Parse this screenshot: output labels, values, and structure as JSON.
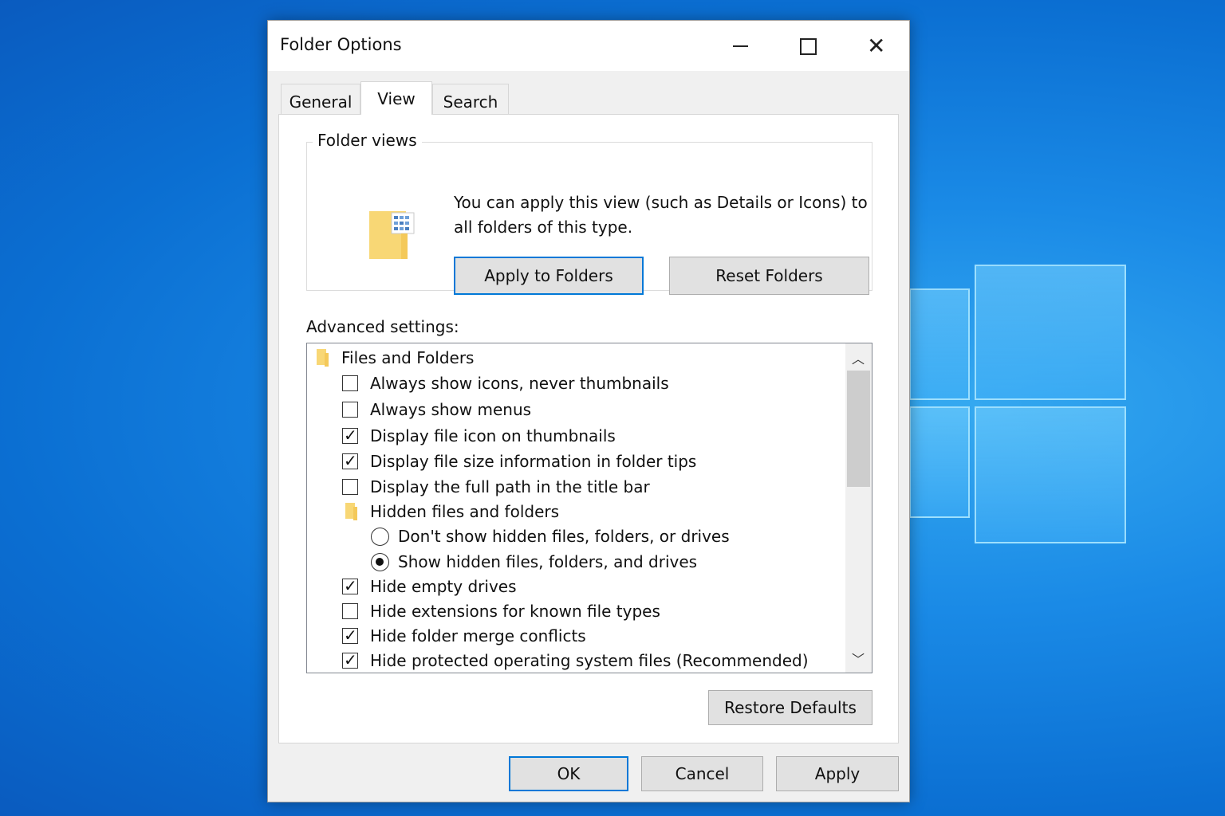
{
  "window": {
    "title": "Folder Options",
    "minimize_icon": "minimize-icon",
    "maximize_icon": "maximize-icon",
    "close_icon": "close-icon",
    "close_glyph": "✕"
  },
  "tabs": [
    {
      "label": "General",
      "active": false
    },
    {
      "label": "View",
      "active": true
    },
    {
      "label": "Search",
      "active": false
    }
  ],
  "folder_views": {
    "label": "Folder views",
    "description": "You can apply this view (such as Details or Icons) to all folders of this type.",
    "apply_button": "Apply to Folders",
    "reset_button": "Reset Folders"
  },
  "advanced": {
    "label": "Advanced settings:",
    "items": [
      {
        "type": "folder",
        "label": "Files and Folders"
      },
      {
        "type": "checkbox",
        "label": "Always show icons, never thumbnails",
        "checked": false
      },
      {
        "type": "checkbox",
        "label": "Always show menus",
        "checked": false
      },
      {
        "type": "checkbox",
        "label": "Display file icon on thumbnails",
        "checked": true
      },
      {
        "type": "checkbox",
        "label": "Display file size information in folder tips",
        "checked": true
      },
      {
        "type": "checkbox",
        "label": "Display the full path in the title bar",
        "checked": false
      },
      {
        "type": "folder",
        "label": "Hidden files and folders"
      },
      {
        "type": "radio",
        "label": "Don't show hidden files, folders, or drives",
        "checked": false
      },
      {
        "type": "radio",
        "label": "Show hidden files, folders, and drives",
        "checked": true
      },
      {
        "type": "checkbox",
        "label": "Hide empty drives",
        "checked": true
      },
      {
        "type": "checkbox",
        "label": "Hide extensions for known file types",
        "checked": false
      },
      {
        "type": "checkbox",
        "label": "Hide folder merge conflicts",
        "checked": true
      },
      {
        "type": "checkbox",
        "label": "Hide protected operating system files (Recommended)",
        "checked": true
      }
    ],
    "scroll_up_glyph": "︿",
    "scroll_down_glyph": "﹀",
    "restore_button": "Restore Defaults"
  },
  "footer": {
    "ok": "OK",
    "cancel": "Cancel",
    "apply": "Apply"
  },
  "colors": {
    "accent": "#0078d7",
    "folder": "#f8d775"
  }
}
